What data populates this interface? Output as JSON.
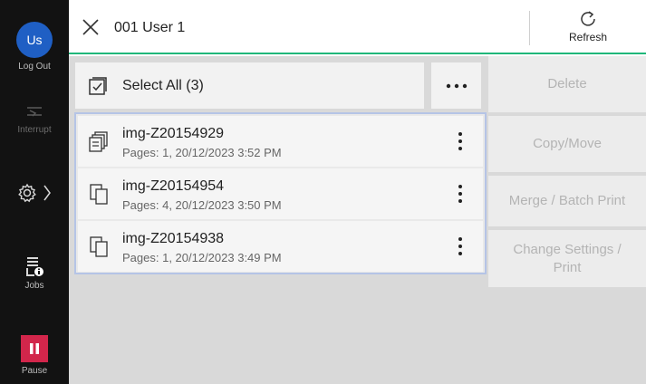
{
  "user": {
    "initials": "Us"
  },
  "rail": {
    "logout_label": "Log Out",
    "interrupt_label": "Interrupt",
    "jobs_label": "Jobs",
    "pause_label": "Pause",
    "icons": [
      "interrupt-icon",
      "gear-icon",
      "chevron-right-icon",
      "jobs-icon",
      "pause-icon"
    ]
  },
  "header": {
    "title": "001 User 1",
    "refresh_label": "Refresh",
    "accent_color": "#1fb77a"
  },
  "toolbar": {
    "select_all_label": "Select All (3)",
    "more_label": "•••"
  },
  "files": [
    {
      "name": "img-Z20154929",
      "meta": "Pages: 1, 20/12/2023 3:52 PM",
      "icon": "multi-doc-icon"
    },
    {
      "name": "img-Z20154954",
      "meta": "Pages: 4, 20/12/2023 3:50 PM",
      "icon": "copy-doc-icon"
    },
    {
      "name": "img-Z20154938",
      "meta": "Pages: 1, 20/12/2023 3:49 PM",
      "icon": "copy-doc-icon"
    }
  ],
  "actions": {
    "delete_label": "Delete",
    "copy_move_label": "Copy/Move",
    "merge_label": "Merge / Batch Print",
    "change_label": "Change Settings / Print"
  },
  "colors": {
    "pause": "#d2264b",
    "avatar": "#1f5fc4",
    "selection_border": "#b5c4e6"
  }
}
